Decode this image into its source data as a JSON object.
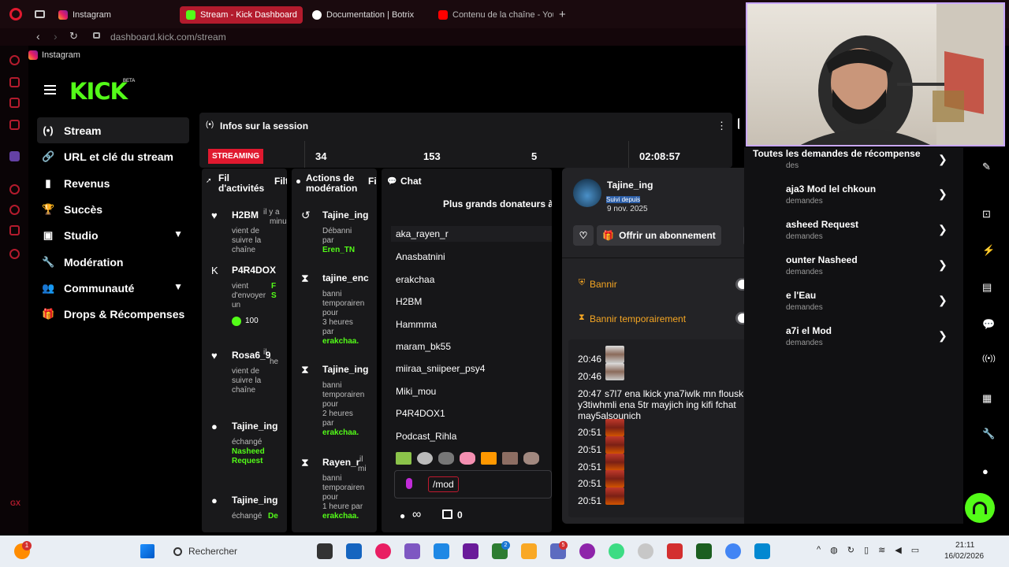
{
  "browser": {
    "tabs": [
      {
        "label": "Instagram",
        "active": false
      },
      {
        "label": "Stream - Kick Dashboard",
        "active": true
      },
      {
        "label": "Documentation | Botrix",
        "active": false
      },
      {
        "label": "Contenu de la chaîne - You",
        "active": false
      }
    ],
    "new_tab": "+",
    "url": "dashboard.kick.com/stream",
    "bookmark": "Instagram"
  },
  "kick": {
    "logo": "KICK",
    "beta": "BETA",
    "nav": [
      {
        "label": "Stream",
        "icon": "(•)",
        "active": true,
        "chevron": false
      },
      {
        "label": "URL et clé du stream",
        "icon": "🔗",
        "active": false,
        "chevron": false
      },
      {
        "label": "Revenus",
        "icon": "▮",
        "active": false,
        "chevron": false
      },
      {
        "label": "Succès",
        "icon": "🏆",
        "active": false,
        "chevron": false
      },
      {
        "label": "Studio",
        "icon": "▣",
        "active": false,
        "chevron": true
      },
      {
        "label": "Modération",
        "icon": "🔧",
        "active": false,
        "chevron": false
      },
      {
        "label": "Communauté",
        "icon": "👥",
        "active": false,
        "chevron": true
      },
      {
        "label": "Drops & Récompenses",
        "icon": "🎁",
        "active": false,
        "chevron": false
      }
    ]
  },
  "session": {
    "title": "Infos sur la session",
    "status": "STREAMING",
    "stats": [
      "34",
      "153",
      "5",
      "02:08:57"
    ]
  },
  "activity": {
    "title": "Fil d'activités",
    "filter": "Filt",
    "items": [
      {
        "name": "H2BM",
        "meta": "il y a",
        "meta2": "minu",
        "text": [
          "vient de",
          "suivre la",
          "chaîne"
        ]
      },
      {
        "name": "P4R4DOX",
        "text": [
          "vient",
          "d'envoyer",
          "un"
        ],
        "side": "F",
        "side2": "S",
        "amount": "100"
      },
      {
        "name": "Rosa6_9",
        "meta": "il",
        "meta2": "he",
        "text": [
          "vient de",
          "suivre la",
          "chaîne"
        ]
      },
      {
        "name": "Tajine_ing",
        "text": [
          "échangé"
        ],
        "reward": [
          "Nasheed",
          "Request"
        ]
      },
      {
        "name": "Tajine_ing",
        "text": [
          "échangé"
        ],
        "reward": [
          "De"
        ]
      }
    ]
  },
  "modactions": {
    "title": "Actions de modération",
    "filter": "Fil",
    "items": [
      {
        "name": "Tajine_ing",
        "text": [
          "Débanni",
          "par"
        ],
        "by": "Eren_TN"
      },
      {
        "name": "tajine_enc",
        "text": [
          "banni",
          "temporairen",
          "pour",
          "3 heures",
          "par"
        ],
        "by": "erakchaa."
      },
      {
        "name": "Tajine_ing",
        "text": [
          "banni",
          "temporairen",
          "pour",
          "2 heures",
          "par"
        ],
        "by": "erakchaa."
      },
      {
        "name": "Rayen_r",
        "meta": "il",
        "meta2": "mi",
        "text": [
          "banni",
          "temporairen",
          "pour",
          "1 heure par"
        ],
        "by": "erakchaa."
      }
    ]
  },
  "chat": {
    "title": "Chat",
    "top_donors": "Plus grands donateurs à",
    "users": [
      "aka_rayen_r",
      "Anasbatnini",
      "erakchaa",
      "H2BM",
      "Hammma",
      "maram_bk55",
      "miiraa_sniipeer_psy4",
      "Miki_mou",
      "P4R4DOX1",
      "Podcast_Rihla"
    ],
    "input": "/mod",
    "footer_left": "∞",
    "footer_count": "0"
  },
  "popup": {
    "username": "Tajine_ing",
    "follow_label": "Suivi depuis",
    "follow_date": "9 nov. 2025",
    "gift_sub": "Offrir un abonnement",
    "ban": "Bannir",
    "timeout": "Bannir temporairement",
    "history": [
      {
        "time": "20:46",
        "msg": ""
      },
      {
        "time": "20:46",
        "msg": ""
      },
      {
        "time": "20:47",
        "msg": "s7l7 ena lkick yna7iwlk mn flousk y3tiwhmli ena 5tr mayjich ing kifi fchat may5alsounich"
      },
      {
        "time": "20:51",
        "msg": ""
      },
      {
        "time": "20:51",
        "msg": ""
      },
      {
        "time": "20:51",
        "msg": ""
      },
      {
        "time": "20:51",
        "msg": ""
      },
      {
        "time": "20:51",
        "msg": ""
      }
    ]
  },
  "rewards": {
    "header": "Toutes les demandes de récompense",
    "header_sub": "des",
    "items": [
      {
        "title": "aja3 Mod lel chkoun",
        "sub": "demandes"
      },
      {
        "title": "asheed Request",
        "sub": "demandes"
      },
      {
        "title": "ounter Nasheed",
        "sub": "demandes"
      },
      {
        "title": "e l'Eau",
        "sub": "demandes"
      },
      {
        "title": "a7i el Mod",
        "sub": "demandes"
      }
    ]
  },
  "taskbar": {
    "search": "Rechercher",
    "time": "21:11",
    "date": "16/02/2026",
    "notif_badge": "1",
    "badges": [
      "2",
      "5"
    ]
  },
  "colors": {
    "kick_green": "#53fc18",
    "opera_red": "#b31b2d",
    "streaming_red": "#e0192f",
    "panel": "#19191b",
    "orange": "#f5a623"
  }
}
